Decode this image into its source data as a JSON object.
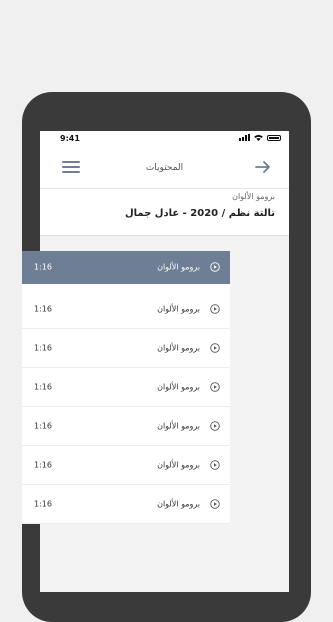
{
  "status": {
    "time": "9:41"
  },
  "topbar": {
    "title": "المحتويات"
  },
  "header": {
    "subtitle": "برومو الألوان",
    "title": "تالتة نظم / 2020 - عادل جمال"
  },
  "lessons": [
    {
      "label": "برومو الألوان",
      "duration": "1:16",
      "active": true
    },
    {
      "label": "برومو الألوان",
      "duration": "1:16",
      "active": false
    },
    {
      "label": "برومو الألوان",
      "duration": "1:16",
      "active": false
    },
    {
      "label": "برومو الألوان",
      "duration": "1:16",
      "active": false
    },
    {
      "label": "برومو الألوان",
      "duration": "1:16",
      "active": false
    },
    {
      "label": "برومو الألوان",
      "duration": "1:16",
      "active": false
    },
    {
      "label": "برومو الألوان",
      "duration": "1:16",
      "active": false
    }
  ],
  "colors": {
    "accent": "#6e7f95",
    "phone_frame": "#3a3a3a",
    "page_bg": "#f0f0f0"
  },
  "icons": {
    "menu": "hamburger-icon",
    "back": "arrow-right-icon",
    "play": "play-circle-icon"
  }
}
